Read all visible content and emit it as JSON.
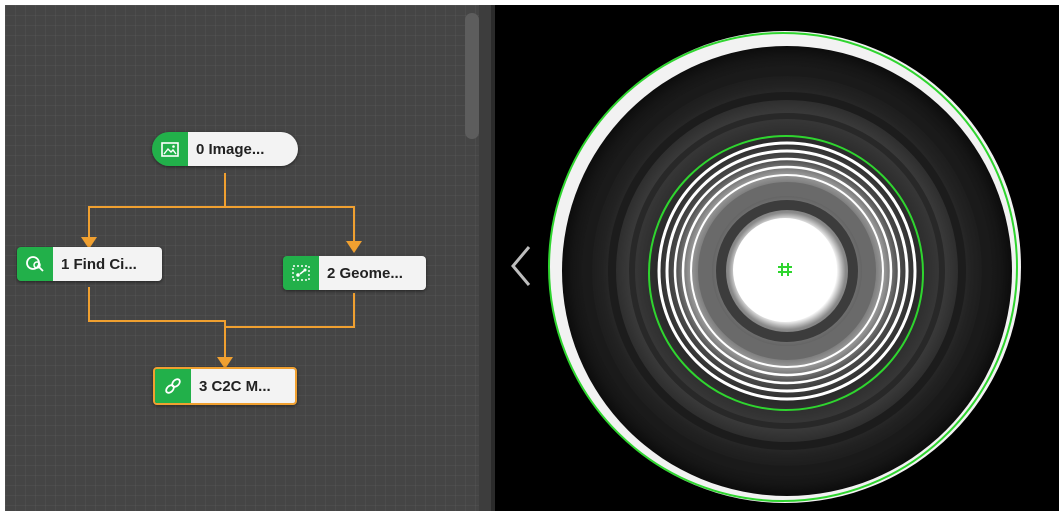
{
  "flow": {
    "nodes": [
      {
        "label": "0 Image...",
        "icon": "image-icon"
      },
      {
        "label": "1 Find Ci...",
        "icon": "find-circle-icon"
      },
      {
        "label": "2 Geome...",
        "icon": "geometry-icon"
      },
      {
        "label": "3 C2C M...",
        "icon": "link-icon",
        "selected": true
      }
    ]
  },
  "viewer": {
    "collapse_icon": "chevron-left-icon"
  },
  "colors": {
    "node_green": "#22b04a",
    "connector_orange": "#f0a030",
    "overlay_green": "#2fd52f",
    "panel_bg": "#454545"
  }
}
